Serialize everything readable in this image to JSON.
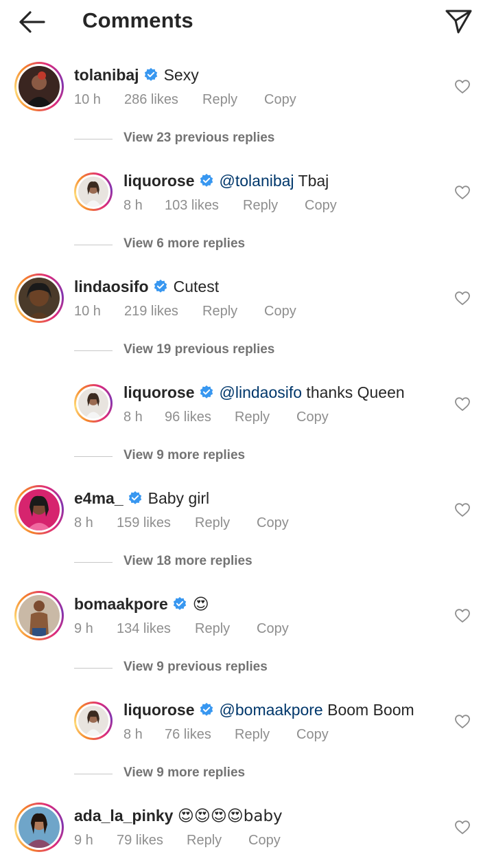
{
  "header": {
    "title": "Comments"
  },
  "comments": [
    {
      "username": "tolanibaj",
      "text": "Sexy",
      "time": "10 h",
      "likes": "286 likes",
      "reply": "Reply",
      "copy": "Copy",
      "view_replies": "View 23 previous replies",
      "reply_thread": {
        "username": "liquorose",
        "mention": "@tolanibaj",
        "text": " Tbaj",
        "time": "8 h",
        "likes": "103 likes",
        "reply": "Reply",
        "copy": "Copy",
        "view_more": "View 6 more replies"
      }
    },
    {
      "username": "lindaosifo",
      "text": "Cutest",
      "time": "10 h",
      "likes": "219 likes",
      "reply": "Reply",
      "copy": "Copy",
      "view_replies": "View 19 previous replies",
      "reply_thread": {
        "username": "liquorose",
        "mention": "@lindaosifo",
        "text": " thanks Queen",
        "time": "8 h",
        "likes": "96 likes",
        "reply": "Reply",
        "copy": "Copy",
        "view_more": "View 9 more replies"
      }
    },
    {
      "username": "e4ma_",
      "text": "Baby girl",
      "time": "8 h",
      "likes": "159 likes",
      "reply": "Reply",
      "copy": "Copy",
      "view_replies": "View 18 more replies"
    },
    {
      "username": "bomaakpore",
      "text": "😍",
      "time": "9 h",
      "likes": "134 likes",
      "reply": "Reply",
      "copy": "Copy",
      "view_replies": "View 9 previous replies",
      "reply_thread": {
        "username": "liquorose",
        "mention": "@bomaakpore",
        "text": " Boom Boom",
        "time": "8 h",
        "likes": "76 likes",
        "reply": "Reply",
        "copy": "Copy",
        "view_more": "View 9 more replies"
      }
    },
    {
      "username": "ada_la_pinky",
      "text": "😍😍😍😍baby",
      "time": "9 h",
      "likes": "79 likes",
      "reply": "Reply",
      "copy": "Copy"
    }
  ],
  "colors": {
    "verified": "#3897f0",
    "mention": "#00376b",
    "secondary_text": "#8e8e8e"
  }
}
